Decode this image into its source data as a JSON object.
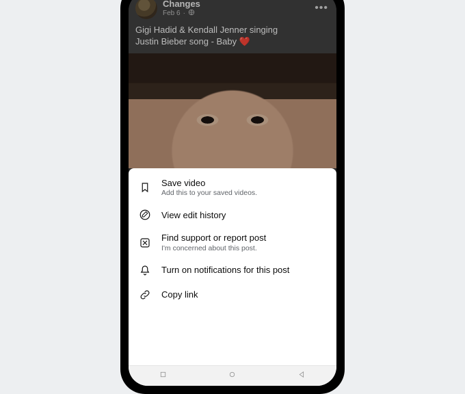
{
  "post": {
    "author": "Changes",
    "date": "Feb 6",
    "privacy_icon": "public",
    "caption_line1": "Gigi Hadid & Kendall Jenner singing",
    "caption_line2": "Justin Bieber song - Baby ❤️"
  },
  "sheet": {
    "save": {
      "title": "Save video",
      "sub": "Add this to your saved videos."
    },
    "edit_history": {
      "title": "View edit history"
    },
    "report": {
      "title": "Find support or report post",
      "sub": "I'm concerned about this post."
    },
    "notifications": {
      "title": "Turn on notifications for this post"
    },
    "copy_link": {
      "title": "Copy link"
    }
  }
}
